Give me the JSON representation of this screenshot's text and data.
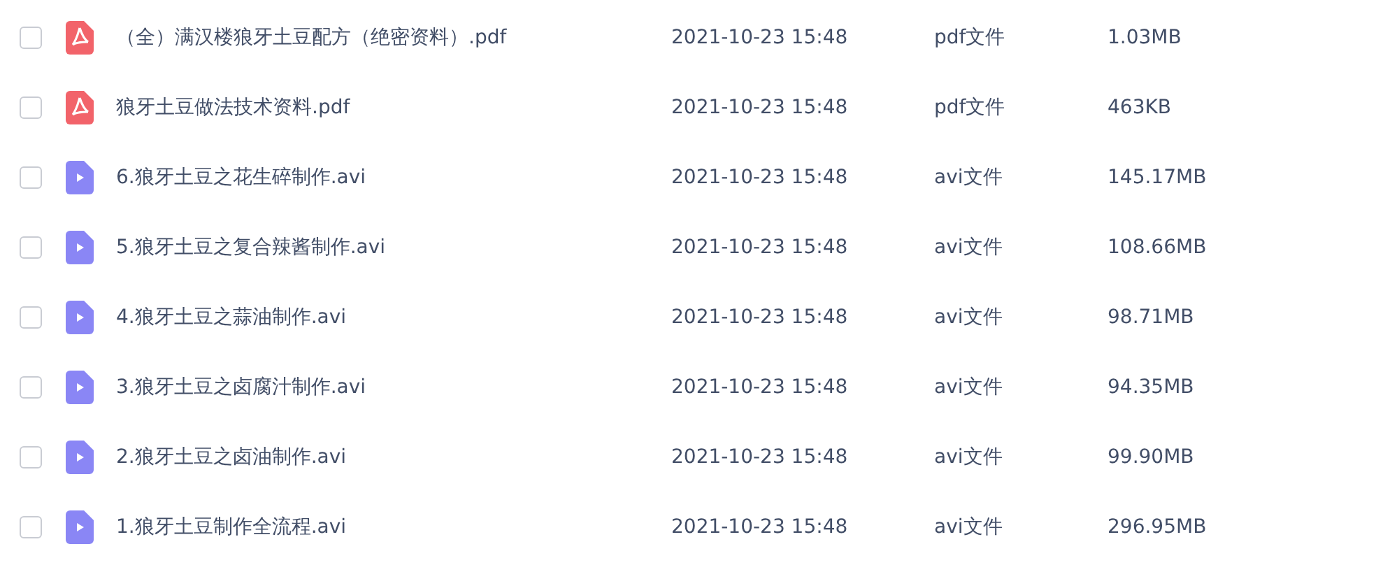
{
  "files": [
    {
      "kind": "pdf",
      "checked": false,
      "name": "（全）满汉楼狼牙土豆配方（绝密资料）.pdf",
      "date": "2021-10-23 15:48",
      "type": "pdf文件",
      "size": "1.03MB"
    },
    {
      "kind": "pdf",
      "checked": false,
      "name": "狼牙土豆做法技术资料.pdf",
      "date": "2021-10-23 15:48",
      "type": "pdf文件",
      "size": "463KB"
    },
    {
      "kind": "video",
      "checked": false,
      "name": "6.狼牙土豆之花生碎制作.avi",
      "date": "2021-10-23 15:48",
      "type": "avi文件",
      "size": "145.17MB"
    },
    {
      "kind": "video",
      "checked": false,
      "name": "5.狼牙土豆之复合辣酱制作.avi",
      "date": "2021-10-23 15:48",
      "type": "avi文件",
      "size": "108.66MB"
    },
    {
      "kind": "video",
      "checked": false,
      "name": "4.狼牙土豆之蒜油制作.avi",
      "date": "2021-10-23 15:48",
      "type": "avi文件",
      "size": "98.71MB"
    },
    {
      "kind": "video",
      "checked": false,
      "name": "3.狼牙土豆之卤腐汁制作.avi",
      "date": "2021-10-23 15:48",
      "type": "avi文件",
      "size": "94.35MB"
    },
    {
      "kind": "video",
      "checked": false,
      "name": "2.狼牙土豆之卤油制作.avi",
      "date": "2021-10-23 15:48",
      "type": "avi文件",
      "size": "99.90MB"
    },
    {
      "kind": "video",
      "checked": false,
      "name": "1.狼牙土豆制作全流程.avi",
      "date": "2021-10-23 15:48",
      "type": "avi文件",
      "size": "296.95MB"
    }
  ]
}
